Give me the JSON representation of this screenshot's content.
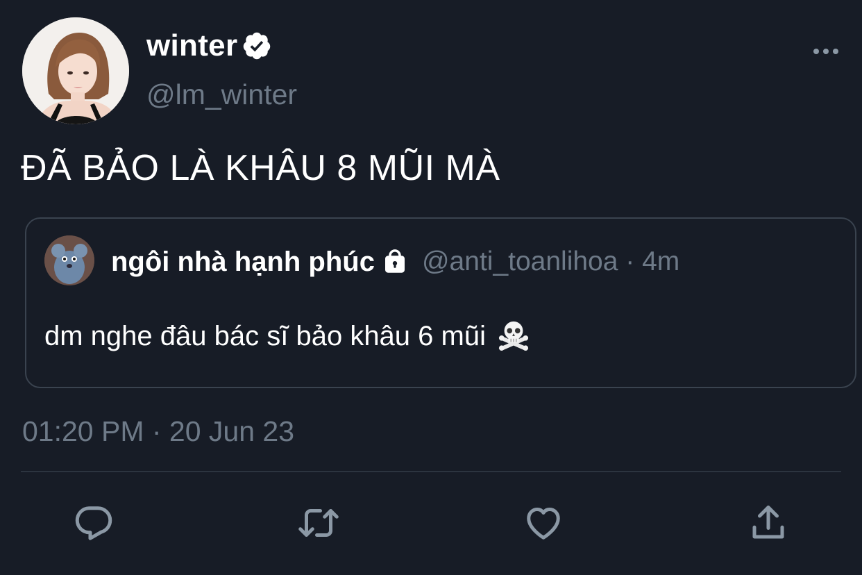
{
  "author": {
    "display_name": "winter",
    "handle": "@lm_winter",
    "verified": true,
    "avatar_icon": "avatar-photo"
  },
  "tweet": {
    "text": "ĐÃ BẢO LÀ KHÂU 8 MŨI MÀ",
    "timestamp": "01:20 PM · 20 Jun 23"
  },
  "quote": {
    "display_name": "ngôi nhà hạnh phúc",
    "protected": true,
    "meta": "@anti_toanlihoa · 4m",
    "text": "dm nghe đâu bác sĩ bảo khâu 6 mũi",
    "emoji_icon": "skull-and-crossbones-icon"
  },
  "actions": [
    {
      "name": "reply",
      "icon": "comment-icon"
    },
    {
      "name": "retweet",
      "icon": "retweet-icon"
    },
    {
      "name": "like",
      "icon": "heart-icon"
    },
    {
      "name": "share",
      "icon": "share-icon"
    }
  ],
  "colors": {
    "background": "#171c26",
    "text_primary": "#ffffff",
    "text_secondary": "#6e7a88",
    "border": "#3a434f",
    "icon": "#8b98a5"
  }
}
